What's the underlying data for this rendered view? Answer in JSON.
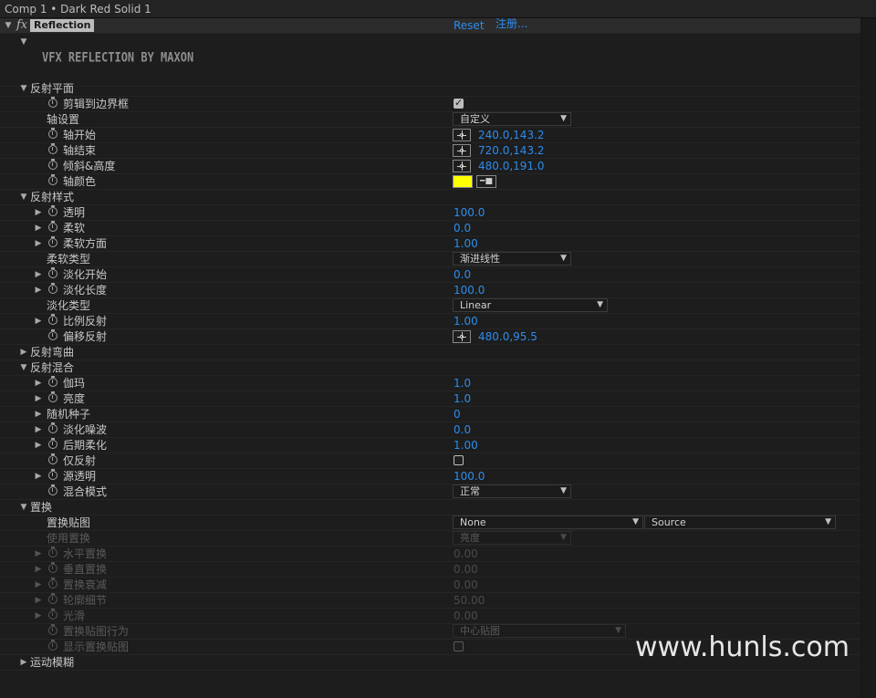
{
  "window": {
    "title": "Comp 1 • Dark Red Solid 1"
  },
  "effect": {
    "fx_label": "fx",
    "name": "Reflection",
    "reset": "Reset",
    "register": "注册...",
    "logo_text": "VFX REFLECTION BY MAXON"
  },
  "groups": {
    "plane": "反射平面",
    "style": "反射样式",
    "bend": "反射弯曲",
    "blend": "反射混合",
    "displace": "置换",
    "motion_blur": "运动模糊"
  },
  "props": {
    "clip_to_bounds": {
      "label": "剪辑到边界框",
      "checked": true
    },
    "axis_setting": {
      "label": "轴设置",
      "value": "自定义"
    },
    "axis_start": {
      "label": "轴开始",
      "value": "240.0,143.2"
    },
    "axis_end": {
      "label": "轴结束",
      "value": "720.0,143.2"
    },
    "tilt_height": {
      "label": "倾斜&高度",
      "value": "480.0,191.0"
    },
    "axis_color": {
      "label": "轴颜色",
      "color": "#ffff00"
    },
    "opacity": {
      "label": "透明",
      "value": "100.0"
    },
    "softness": {
      "label": "柔软",
      "value": "0.0"
    },
    "soft_direction": {
      "label": "柔软方面",
      "value": "1.00"
    },
    "soft_type": {
      "label": "柔软类型",
      "value": "渐进线性"
    },
    "fade_start": {
      "label": "淡化开始",
      "value": "0.0"
    },
    "fade_length": {
      "label": "淡化长度",
      "value": "100.0"
    },
    "fade_type": {
      "label": "淡化类型",
      "value": "Linear"
    },
    "scale_reflection": {
      "label": "比例反射",
      "value": "1.00"
    },
    "offset_reflection": {
      "label": "偏移反射",
      "value": "480.0,95.5"
    },
    "gamma": {
      "label": "伽玛",
      "value": "1.0"
    },
    "brightness": {
      "label": "亮度",
      "value": "1.0"
    },
    "random_seed": {
      "label": "随机种子",
      "value": "0"
    },
    "fade_noise": {
      "label": "淡化噪波",
      "value": "0.0"
    },
    "post_soften": {
      "label": "后期柔化",
      "value": "1.00"
    },
    "reflection_only": {
      "label": "仅反射",
      "checked": false
    },
    "source_opacity": {
      "label": "源透明",
      "value": "100.0"
    },
    "blend_mode": {
      "label": "混合模式",
      "value": "正常"
    },
    "displace_map": {
      "label": "置换贴图",
      "value": "None",
      "value2": "Source"
    },
    "use_displace": {
      "label": "使用置换",
      "value": "亮度"
    },
    "h_displace": {
      "label": "水平置换",
      "value": "0.00"
    },
    "v_displace": {
      "label": "垂直置换",
      "value": "0.00"
    },
    "displace_falloff": {
      "label": "置换衰减",
      "value": "0.00"
    },
    "contour_detail": {
      "label": "轮廓细节",
      "value": "50.00"
    },
    "smooth": {
      "label": "光滑",
      "value": "0.00"
    },
    "map_behavior": {
      "label": "置换贴图行为",
      "value": "中心贴图"
    },
    "show_map": {
      "label": "显示置换贴图",
      "checked": false
    }
  },
  "watermark": "www.hunls.com"
}
